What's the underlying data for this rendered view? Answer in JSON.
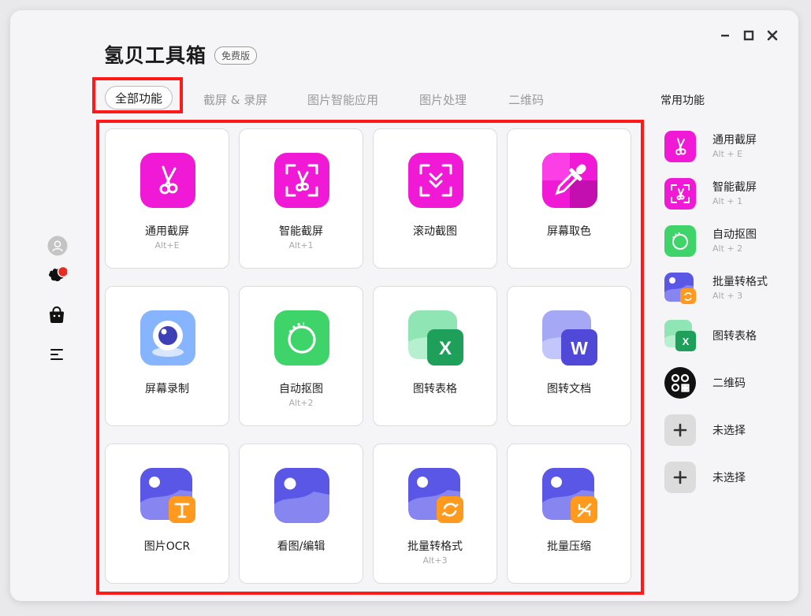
{
  "app": {
    "title": "氢贝工具箱",
    "edition": "免费版"
  },
  "tabs": [
    {
      "label": "全部功能",
      "active": true
    },
    {
      "label": "截屏 & 录屏"
    },
    {
      "label": "图片智能应用"
    },
    {
      "label": "图片处理"
    },
    {
      "label": "二维码"
    }
  ],
  "tools": [
    {
      "label": "通用截屏",
      "shortcut": "Alt+E",
      "icon": "scissors-icon"
    },
    {
      "label": "智能截屏",
      "shortcut": "Alt+1",
      "icon": "smart-screenshot-icon"
    },
    {
      "label": "滚动截图",
      "shortcut": "",
      "icon": "scroll-screenshot-icon"
    },
    {
      "label": "屏幕取色",
      "shortcut": "",
      "icon": "eyedropper-icon"
    },
    {
      "label": "屏幕录制",
      "shortcut": "",
      "icon": "webcam-icon"
    },
    {
      "label": "自动抠图",
      "shortcut": "Alt+2",
      "icon": "auto-cutout-icon"
    },
    {
      "label": "图转表格",
      "shortcut": "",
      "icon": "excel-icon"
    },
    {
      "label": "图转文档",
      "shortcut": "",
      "icon": "word-icon"
    },
    {
      "label": "图片OCR",
      "shortcut": "",
      "icon": "ocr-icon"
    },
    {
      "label": "看图/编辑",
      "shortcut": "",
      "icon": "image-viewer-icon"
    },
    {
      "label": "批量转格式",
      "shortcut": "Alt+3",
      "icon": "batch-convert-icon"
    },
    {
      "label": "批量压缩",
      "shortcut": "",
      "icon": "batch-compress-icon"
    }
  ],
  "favorites": {
    "title": "常用功能",
    "items": [
      {
        "label": "通用截屏",
        "shortcut": "Alt + E",
        "icon": "scissors-icon"
      },
      {
        "label": "智能截屏",
        "shortcut": "Alt + 1",
        "icon": "smart-screenshot-icon"
      },
      {
        "label": "自动抠图",
        "shortcut": "Alt + 2",
        "icon": "auto-cutout-icon"
      },
      {
        "label": "批量转格式",
        "shortcut": "Alt + 3",
        "icon": "batch-convert-icon"
      },
      {
        "label": "图转表格",
        "shortcut": "",
        "icon": "excel-icon"
      },
      {
        "label": "二维码",
        "shortcut": "",
        "icon": "qr-code-icon"
      },
      {
        "label": "未选择",
        "shortcut": "",
        "icon": "plus-icon"
      },
      {
        "label": "未选择",
        "shortcut": "",
        "icon": "plus-icon"
      }
    ]
  },
  "sidebar": [
    {
      "icon": "avatar-icon"
    },
    {
      "icon": "gift-icon",
      "badge": true
    },
    {
      "icon": "shopping-bag-icon"
    },
    {
      "icon": "menu-icon"
    }
  ],
  "colors": {
    "magenta": "#f019d6",
    "green": "#3fd46a",
    "purple": "#5a57e6",
    "orange": "#ff9a1f",
    "excel": "#1fa05a",
    "highlight": "#ff1a1a"
  }
}
